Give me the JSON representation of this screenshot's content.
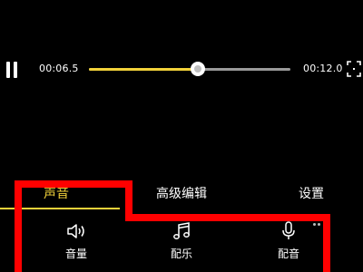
{
  "player": {
    "current_time": "00:06.5",
    "total_time": "00:12.0",
    "progress_fraction": 0.54,
    "progress_color": "#f2d23a"
  },
  "tabs": [
    {
      "label": "声音",
      "active": true
    },
    {
      "label": "高级编辑",
      "active": false
    },
    {
      "label": "设置",
      "active": false
    }
  ],
  "tools": [
    {
      "label": "音量",
      "icon": "speaker-icon"
    },
    {
      "label": "配乐",
      "icon": "music-note-icon"
    },
    {
      "label": "配音",
      "icon": "microphone-icon"
    }
  ],
  "colors": {
    "background": "#000000",
    "accent": "#f2d23a",
    "annotation": "#ff0000"
  }
}
